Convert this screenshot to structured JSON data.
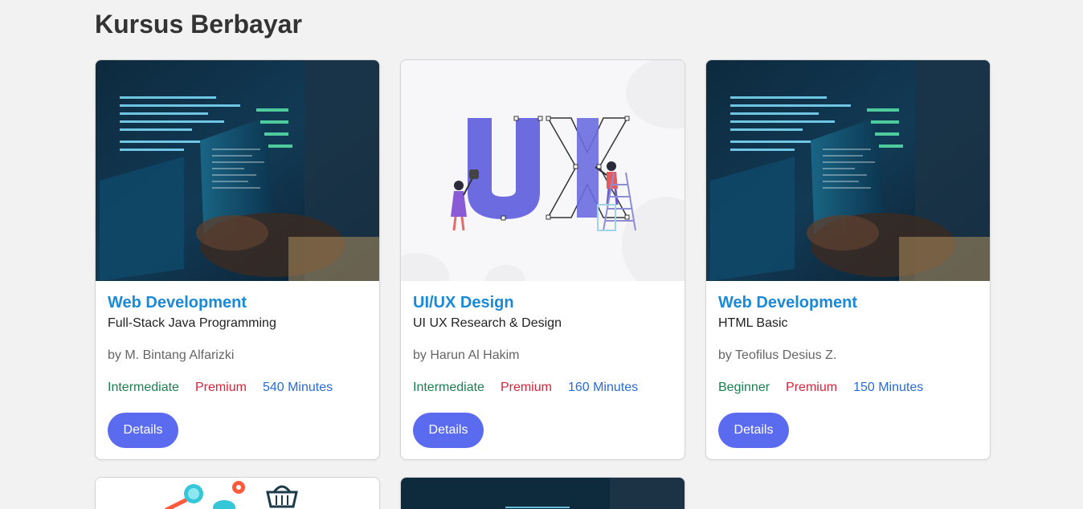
{
  "section": {
    "title": "Kursus Berbayar"
  },
  "cards": [
    {
      "category": "Web Development",
      "course": "Full-Stack Java Programming",
      "author": "by M. Bintang Alfarizki",
      "level": "Intermediate",
      "price": "Premium",
      "duration": "540 Minutes",
      "button": "Details",
      "image": "code-screen-image"
    },
    {
      "category": "UI/UX Design",
      "course": "UI UX Research & Design",
      "author": "by Harun Al Hakim",
      "level": "Intermediate",
      "price": "Premium",
      "duration": "160 Minutes",
      "button": "Details",
      "image": "ux-illustration-image"
    },
    {
      "category": "Web Development",
      "course": "HTML Basic",
      "author": "by Teofilus Desius Z.",
      "level": "Beginner",
      "price": "Premium",
      "duration": "150 Minutes",
      "button": "Details",
      "image": "code-screen-image"
    }
  ],
  "colors": {
    "category": "#1a8ad8",
    "level": "#1a8050",
    "price": "#d9233a",
    "duration": "#2a6bd4",
    "button": "#5b6bf0",
    "background": "#f2f2f2"
  }
}
